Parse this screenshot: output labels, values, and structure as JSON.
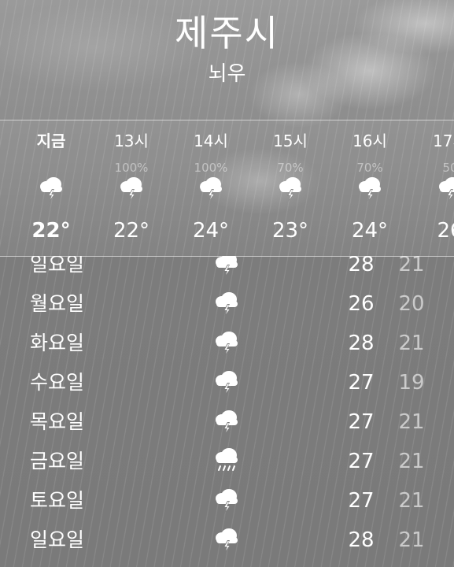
{
  "location": {
    "city": "제주시",
    "condition": "뇌우"
  },
  "hourly": [
    {
      "time": "지금",
      "pop": "",
      "icon": "thunderstorm-icon",
      "temp": "22°"
    },
    {
      "time": "13시",
      "pop": "100%",
      "icon": "thunderstorm-icon",
      "temp": "22°"
    },
    {
      "time": "14시",
      "pop": "100%",
      "icon": "thunderstorm-icon",
      "temp": "24°"
    },
    {
      "time": "15시",
      "pop": "70%",
      "icon": "thunderstorm-icon",
      "temp": "23°"
    },
    {
      "time": "16시",
      "pop": "70%",
      "icon": "thunderstorm-icon",
      "temp": "24°"
    },
    {
      "time": "17시",
      "pop": "50",
      "icon": "thunderstorm-icon",
      "temp": "26"
    }
  ],
  "daily": [
    {
      "day": "일요일",
      "icon": "thunderstorm-icon",
      "high": "28",
      "low": "21"
    },
    {
      "day": "월요일",
      "icon": "thunderstorm-icon",
      "high": "26",
      "low": "20"
    },
    {
      "day": "화요일",
      "icon": "thunderstorm-icon",
      "high": "28",
      "low": "21"
    },
    {
      "day": "수요일",
      "icon": "thunderstorm-icon",
      "high": "27",
      "low": "19"
    },
    {
      "day": "목요일",
      "icon": "thunderstorm-icon",
      "high": "27",
      "low": "21"
    },
    {
      "day": "금요일",
      "icon": "rain-icon",
      "high": "27",
      "low": "21"
    },
    {
      "day": "토요일",
      "icon": "thunderstorm-icon",
      "high": "27",
      "low": "21"
    },
    {
      "day": "일요일",
      "icon": "thunderstorm-icon",
      "high": "28",
      "low": "21"
    }
  ],
  "colors": {
    "background": "#8a8a8a",
    "text": "#ffffff",
    "low_temp": "#cfcfcf"
  }
}
